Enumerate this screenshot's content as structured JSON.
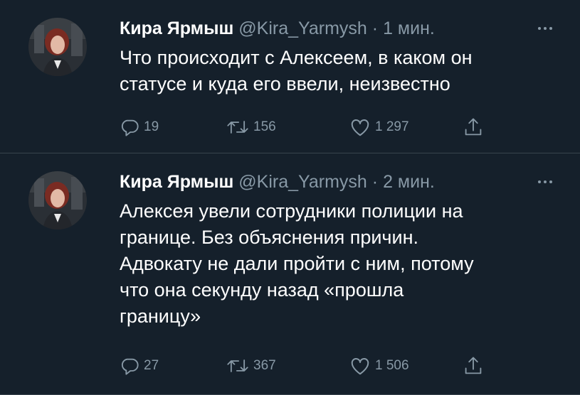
{
  "tweets": [
    {
      "name": "Кира Ярмыш",
      "handle": "@Kira_Yarmysh",
      "separator": "·",
      "time": "1 мин.",
      "text": "Что происходит с Алексеем, в каком он\nстатусе и куда его ввели, неизвестно",
      "replies": "19",
      "retweets": "156",
      "likes": "1 297"
    },
    {
      "name": "Кира Ярмыш",
      "handle": "@Kira_Yarmysh",
      "separator": "·",
      "time": "2 мин.",
      "text": "Алексея увели сотрудники полиции на\nгранице. Без объяснения причин.\nАдвокату не дали пройти с ним, потому\nчто она секунду назад «прошла\nграницу»",
      "replies": "27",
      "retweets": "367",
      "likes": "1 506"
    }
  ],
  "colors": {
    "background": "#15202b",
    "divider": "#38444d",
    "text_primary": "#ffffff",
    "text_secondary": "#8899a6"
  },
  "icons": {
    "reply": "reply-icon",
    "retweet": "retweet-icon",
    "like": "heart-icon",
    "share": "share-icon",
    "more": "more-options-icon"
  }
}
